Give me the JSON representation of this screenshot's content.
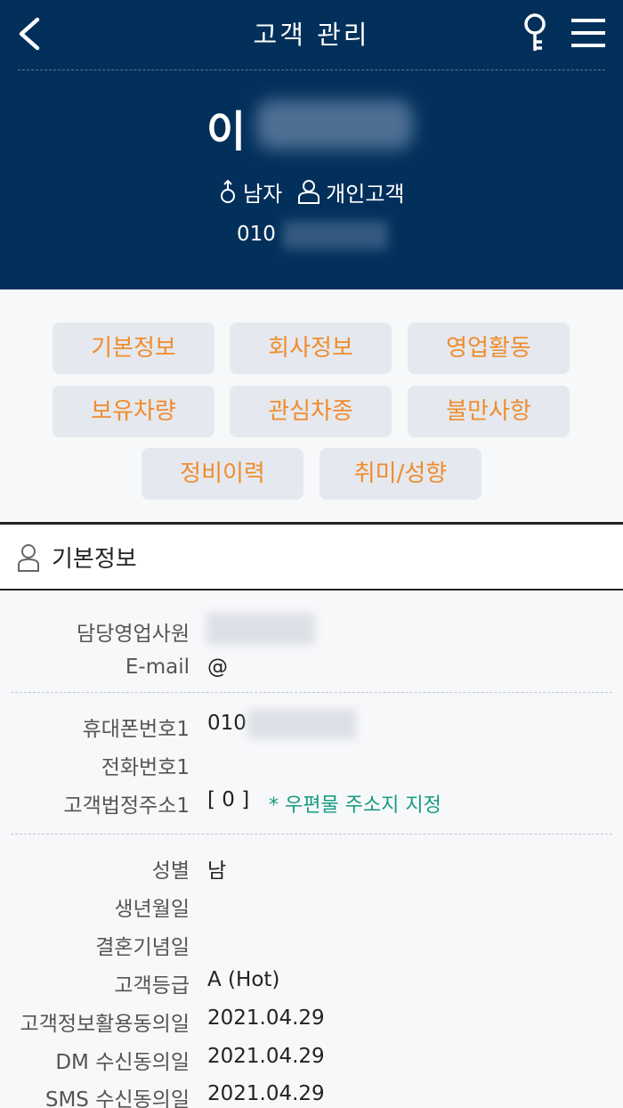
{
  "header": {
    "title": "고객 관리",
    "customer_name": "이",
    "gender": "남자",
    "customer_type": "개인고객",
    "phone": "010"
  },
  "icons": {
    "back": "chevron-left-icon",
    "key": "key-icon",
    "menu": "hamburger-menu-icon",
    "gender": "male-icon",
    "person": "person-icon"
  },
  "tabs": [
    "기본정보",
    "회사정보",
    "영업활동",
    "보유차량",
    "관심차종",
    "불만사항",
    "정비이력",
    "취미/성향"
  ],
  "section": {
    "title": "기본정보"
  },
  "info": {
    "sales_rep_label": "담당영업사원",
    "email_label": "E-mail",
    "email_value": "@",
    "mobile_label": "휴대폰번호1",
    "mobile_value": "010",
    "tel_label": "전화번호1",
    "address_label": "고객법정주소1",
    "address_value": "[ 0 ]",
    "address_note": "* 우편물 주소지 지정",
    "gender_label": "성별",
    "gender_value": "남",
    "birthday_label": "생년월일",
    "anniversary_label": "결혼기념일",
    "grade_label": "고객등급",
    "grade_value": "A (Hot)",
    "consent_label": "고객정보활용동의일",
    "consent_value": "2021.04.29",
    "dm_label": "DM 수신동의일",
    "dm_value": "2021.04.29",
    "sms_label": "SMS 수신동의일",
    "sms_value": "2021.04.29"
  },
  "colors": {
    "header_bg": "#02305b",
    "tab_text": "#f08c2c",
    "tab_bg": "#e5e8ee",
    "note_green": "#179a80",
    "page_bg": "#f7f8fa"
  }
}
